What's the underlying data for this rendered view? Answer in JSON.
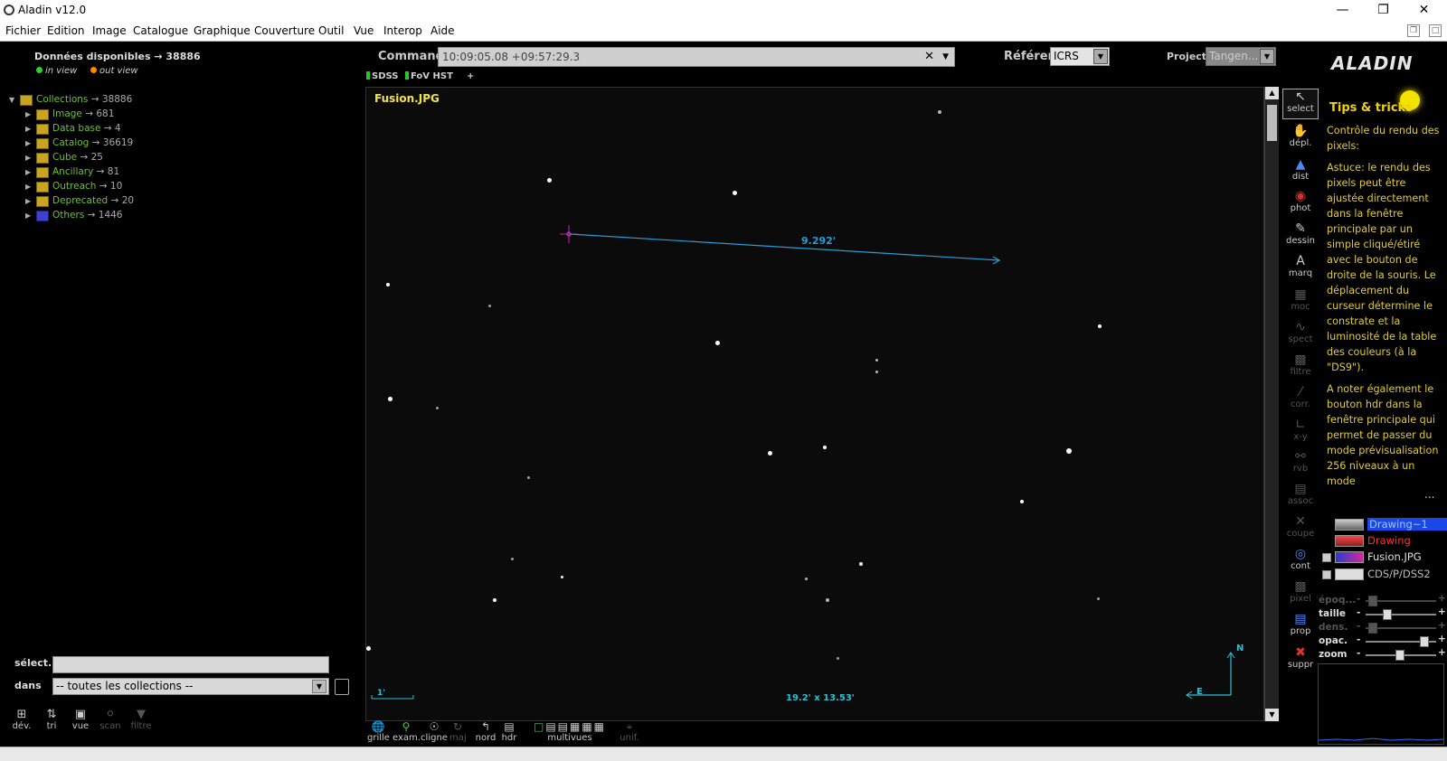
{
  "window": {
    "title": "Aladin v12.0"
  },
  "menu": [
    "Fichier",
    "Edition",
    "Image",
    "Catalogue",
    "Graphique",
    "Couverture",
    "Outil",
    "Vue",
    "Interop",
    "Aide"
  ],
  "left": {
    "title": "Données disponibles → 38886",
    "legend_in": "in view",
    "legend_out": "out view",
    "tree": [
      {
        "label": "Collections",
        "count": " → 38886"
      },
      {
        "label": "Image",
        "count": " → 681"
      },
      {
        "label": "Data base",
        "count": " → 4"
      },
      {
        "label": "Catalog",
        "count": " → 36619"
      },
      {
        "label": "Cube",
        "count": " → 25"
      },
      {
        "label": "Ancillary",
        "count": " → 81"
      },
      {
        "label": "Outreach",
        "count": " → 10"
      },
      {
        "label": "Deprecated",
        "count": " → 20"
      },
      {
        "label": "Others",
        "count": " → 1446"
      }
    ],
    "select_label": "sélect.",
    "dans_label": "dans",
    "dans_value": "-- toutes les collections --",
    "tools": [
      "dév.",
      "tri",
      "vue",
      "scan",
      "filtre"
    ]
  },
  "command": {
    "label": "Commande",
    "value": "10:09:05.08 +09:57:29.3",
    "ref_label": "Référentiel",
    "ref_value": "ICRS",
    "proj_label": "Projection",
    "proj_value": "Tangen..."
  },
  "surveys": [
    "SDSS",
    "FoV HST",
    "+"
  ],
  "view": {
    "image_title": "Fusion.JPG",
    "distance": "9.292'",
    "fov": "19.2' x 13.53'",
    "scale": "1'",
    "north": "N",
    "east": "E"
  },
  "right_tools": [
    "select",
    "dépl.",
    "dist",
    "phot",
    "dessin",
    "marq",
    "moc",
    "spect",
    "filtre",
    "corr.",
    "x-y",
    "rvb",
    "assoc",
    "coupe",
    "cont",
    "pixel",
    "prop",
    "suppr"
  ],
  "tips": {
    "logo": "ALADIN",
    "title": "Tips & tricks",
    "paragraphs": [
      "Contrôle du rendu des pixels:",
      "Astuce: le rendu des pixels peut être ajustée directement dans la fenêtre principale par un simple cliqué/étiré avec le bouton de droite de la souris. Le déplacement du curseur détermine le constrate et la luminosité de la table des couleurs (à la \"DS9\").",
      "A noter également le bouton hdr dans la fenêtre principale qui permet de passer du mode prévisualisation 256 niveaux à un mode"
    ],
    "more": "..."
  },
  "layers": [
    {
      "name": "Drawing~1",
      "color": "#2a6ef0"
    },
    {
      "name": "Drawing",
      "color": "#ff3030"
    },
    {
      "name": "Fusion.JPG",
      "color": "#e0e0e0"
    },
    {
      "name": "CDS/P/DSS2",
      "color": "#bbbbbb"
    }
  ],
  "sliders": [
    {
      "label": "époq...",
      "level": 0.05,
      "dim": true
    },
    {
      "label": "taille",
      "level": 0.28,
      "dim": false
    },
    {
      "label": "dens.",
      "level": 0.05,
      "dim": true
    },
    {
      "label": "opac.",
      "level": 0.88,
      "dim": false
    },
    {
      "label": "zoom",
      "level": 0.48,
      "dim": false
    }
  ],
  "bottom_tools": [
    "grille",
    "exam.",
    "cligne",
    "maj",
    "nord",
    "hdr",
    "multivues",
    "unif."
  ],
  "colors": {
    "accent_green": "#6cc22c",
    "tips_yellow": "#e0cc30",
    "measure_blue": "#2a9bd6"
  }
}
